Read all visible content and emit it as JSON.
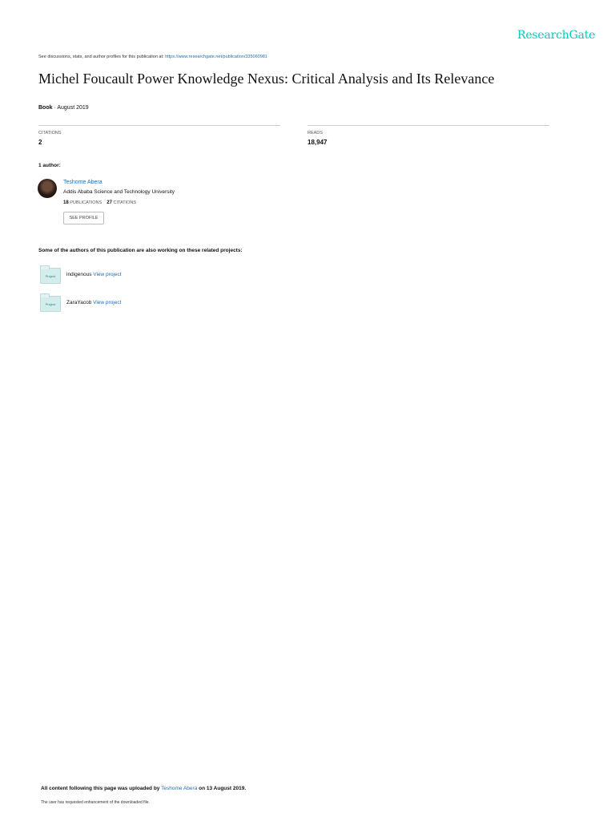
{
  "header": {
    "logo": "ResearchGate",
    "see_discussions": "See discussions, stats, and author profiles for this publication at:",
    "publication_url": "https://www.researchgate.net/publication/335060981"
  },
  "publication": {
    "title": "Michel Foucault Power Knowledge Nexus: Critical Analysis and Its Relevance",
    "type": "Book",
    "separator": " · ",
    "date": "August 2019"
  },
  "stats": {
    "citations_label": "CITATIONS",
    "citations_value": "2",
    "reads_label": "READS",
    "reads_value": "18,947"
  },
  "authors": {
    "heading": "1 author:",
    "list": [
      {
        "name": "Teshome Abera",
        "institution": "Addis Ababa Science and Technology University",
        "publications_count": "18",
        "publications_label": "PUBLICATIONS",
        "citations_count": "27",
        "citations_label": "CITATIONS",
        "profile_button": "SEE PROFILE"
      }
    ]
  },
  "related": {
    "heading": "Some of the authors of this publication are also working on these related projects:",
    "icon_label": "Project",
    "projects": [
      {
        "name": "indigenous",
        "link": "View project"
      },
      {
        "name": "ZaraYacob",
        "link": "View project"
      }
    ]
  },
  "footer": {
    "uploaded_prefix": "All content following this page was uploaded by",
    "uploader": "Teshome Abera",
    "uploaded_suffix": "on 13 August 2019.",
    "note": "The user has requested enhancement of the downloaded file."
  },
  "colors": {
    "brand": "#00ccbb",
    "link": "#1f6fb5"
  }
}
